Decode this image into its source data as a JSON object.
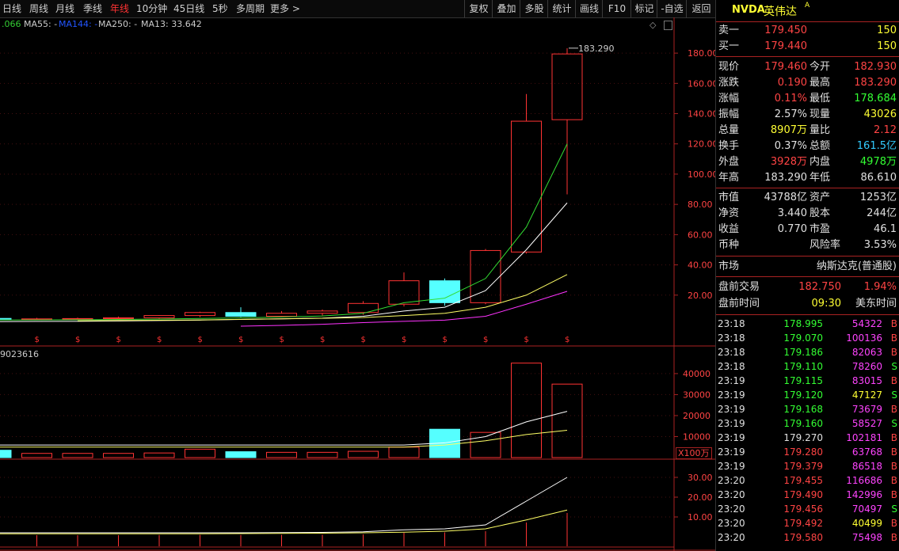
{
  "toolbar": {
    "periods": [
      "日线",
      "周线",
      "月线",
      "季线",
      "年线",
      "10分钟",
      "45日线",
      "5秒",
      "多周期",
      "更多 >"
    ],
    "active_index": 4,
    "tools": [
      "复权",
      "叠加",
      "多股",
      "统计",
      "画线",
      "F10",
      "标记",
      "-自选",
      "返回"
    ]
  },
  "ma_legend": [
    {
      "text": ".066",
      "color": "#33cc33"
    },
    {
      "text": "MA55: -",
      "color": "#cccccc"
    },
    {
      "text": "MA144: -",
      "color": "#2255ff"
    },
    {
      "text": "MA250: -",
      "color": "#cccccc"
    },
    {
      "text": "MA13: 33.642",
      "color": "#cccccc"
    }
  ],
  "vol_legend": "9023616",
  "volume_unit": "X100万",
  "chart_data": {
    "type": "candlestick",
    "price_axis": {
      "ticks": [
        "180.00",
        "160.00",
        "140.00",
        "120.00",
        "100.00",
        "80.00",
        "60.00",
        "40.00",
        "20.00"
      ],
      "ylim": [
        0,
        190
      ]
    },
    "volume_axis": {
      "ticks": [
        "40000",
        "30000",
        "20000",
        "10000"
      ],
      "ylim": [
        0,
        46000
      ]
    },
    "indicator_axis": {
      "ticks": [
        "30.00",
        "20.00",
        "10.00"
      ],
      "ylim": [
        0,
        32
      ]
    },
    "annotation": "183.290",
    "dividend_marker": "$",
    "candles": [
      {
        "open": 4.5,
        "high": 5.2,
        "low": 3.8,
        "close": 4.6,
        "volume": 3500,
        "ind": 2.0,
        "color": "cyan"
      },
      {
        "open": 4.2,
        "high": 5.0,
        "low": 3.5,
        "close": 4.3,
        "volume": 2000,
        "ind": 2.0,
        "color": "red"
      },
      {
        "open": 4.4,
        "high": 5.1,
        "low": 3.7,
        "close": 4.5,
        "volume": 2000,
        "ind": 2.0,
        "color": "red"
      },
      {
        "open": 4.8,
        "high": 5.8,
        "low": 4.0,
        "close": 5.0,
        "volume": 2000,
        "ind": 2.0,
        "color": "red"
      },
      {
        "open": 5.0,
        "high": 6.8,
        "low": 4.5,
        "close": 6.5,
        "volume": 2200,
        "ind": 2.2,
        "color": "red"
      },
      {
        "open": 6.5,
        "high": 9.0,
        "low": 5.5,
        "close": 8.5,
        "volume": 4000,
        "ind": 2.4,
        "color": "red"
      },
      {
        "open": 8.5,
        "high": 12.0,
        "low": 5.5,
        "close": 6.0,
        "volume": 2800,
        "ind": 2.3,
        "color": "cyan"
      },
      {
        "open": 6.0,
        "high": 9.5,
        "low": 5.5,
        "close": 8.0,
        "volume": 2500,
        "ind": 2.4,
        "color": "red"
      },
      {
        "open": 8.0,
        "high": 10.5,
        "low": 6.5,
        "close": 9.5,
        "volume": 2500,
        "ind": 2.6,
        "color": "red"
      },
      {
        "open": 8.5,
        "high": 16.0,
        "low": 7.0,
        "close": 14.5,
        "volume": 3000,
        "ind": 3.0,
        "color": "red"
      },
      {
        "open": 14.0,
        "high": 35.0,
        "low": 12.5,
        "close": 29.5,
        "volume": 5000,
        "ind": 5.0,
        "color": "red"
      },
      {
        "open": 29.5,
        "high": 31.0,
        "low": 13.0,
        "close": 15.0,
        "volume": 13500,
        "ind": 5.5,
        "color": "cyan"
      },
      {
        "open": 15.0,
        "high": 50.5,
        "low": 14.0,
        "close": 49.5,
        "volume": 12000,
        "ind": 7.0,
        "color": "red"
      },
      {
        "open": 48.5,
        "high": 153.0,
        "low": 47.5,
        "close": 135.0,
        "volume": 45000,
        "ind": 18.0,
        "color": "red"
      },
      {
        "open": 136.0,
        "high": 183.29,
        "low": 86.61,
        "close": 179.46,
        "volume": 35000,
        "ind": 30.0,
        "color": "red"
      }
    ],
    "ma_green": [
      3.5,
      3.6,
      3.7,
      3.9,
      4.2,
      4.6,
      5.0,
      5.5,
      6.2,
      8.0,
      15.0,
      18.0,
      31.0,
      65.0,
      120.0
    ],
    "ma_white": [
      2.5,
      2.6,
      2.7,
      2.9,
      3.2,
      3.5,
      3.9,
      4.3,
      4.8,
      6.0,
      9.5,
      12.0,
      23.0,
      50.0,
      81.0
    ],
    "ma_yellow": [
      null,
      null,
      3.0,
      3.2,
      3.4,
      3.6,
      4.0,
      4.3,
      4.7,
      5.2,
      6.5,
      8.0,
      12.0,
      20.0,
      33.6
    ],
    "ma_magenta": [
      null,
      null,
      null,
      null,
      null,
      null,
      -0.5,
      0.0,
      0.7,
      1.8,
      2.7,
      3.5,
      6.0,
      14.0,
      22.5
    ],
    "vol_ma_white": [
      6000,
      6000,
      6000,
      6000,
      6000,
      6000,
      6000,
      6000,
      6000,
      6000,
      6000,
      7000,
      10000,
      17000,
      22000
    ],
    "vol_ma_yellow": [
      5000,
      5000,
      5000,
      5000,
      5000,
      5000,
      5000,
      5000,
      5000,
      5000,
      5000,
      6000,
      8000,
      11000,
      13000
    ],
    "ind_line_white": [
      2.0,
      2.0,
      2.0,
      2.0,
      2.0,
      2.0,
      2.0,
      2.1,
      2.2,
      2.5,
      3.5,
      4.0,
      6.0,
      18.0,
      30.0
    ],
    "ind_line_yellow": [
      1.5,
      1.5,
      1.5,
      1.5,
      1.5,
      1.5,
      1.6,
      1.7,
      1.8,
      2.0,
      2.3,
      2.8,
      4.0,
      8.5,
      13.5
    ]
  },
  "panel": {
    "ticker": "NVDA",
    "name": "英伟达",
    "badge": "A",
    "ask": {
      "label": "卖一",
      "price": "179.450",
      "vol": "150"
    },
    "bid": {
      "label": "买一",
      "price": "179.440",
      "vol": "150"
    },
    "quote_rows": [
      {
        "l1": "现价",
        "v1": "179.460",
        "c1": "#ff4444",
        "l2": "今开",
        "v2": "182.930",
        "c2": "#ff4444"
      },
      {
        "l1": "涨跌",
        "v1": "0.190",
        "c1": "#ff4444",
        "l2": "最高",
        "v2": "183.290",
        "c2": "#ff4444"
      },
      {
        "l1": "涨幅",
        "v1": "0.11%",
        "c1": "#ff4444",
        "l2": "最低",
        "v2": "178.684",
        "c2": "#33ff33"
      },
      {
        "l1": "振幅",
        "v1": "2.57%",
        "c1": "#e0e0e0",
        "l2": "现量",
        "v2": "43026",
        "c2": "#ffff33"
      },
      {
        "l1": "总量",
        "v1": "8907万",
        "c1": "#ffff33",
        "l2": "量比",
        "v2": "2.12",
        "c2": "#ff4444"
      },
      {
        "l1": "换手",
        "v1": "0.37%",
        "c1": "#e0e0e0",
        "l2": "总额",
        "v2": "161.5亿",
        "c2": "#33ccff"
      },
      {
        "l1": "外盘",
        "v1": "3928万",
        "c1": "#ff4444",
        "l2": "内盘",
        "v2": "4978万",
        "c2": "#33ff33"
      },
      {
        "l1": "年高",
        "v1": "183.290",
        "c1": "#e0e0e0",
        "l2": "年低",
        "v2": "86.610",
        "c2": "#e0e0e0"
      }
    ],
    "fund_rows": [
      {
        "l1": "市值",
        "v1": "43788亿",
        "l2": "资产",
        "v2": "1253亿"
      },
      {
        "l1": "净资",
        "v1": "3.440",
        "l2": "股本",
        "v2": "244亿"
      },
      {
        "l1": "收益",
        "v1": "0.770",
        "l2": "市盈",
        "v2": "46.1"
      },
      {
        "l1": "币种",
        "v1": "",
        "l2": "风险率",
        "v2": "3.53%"
      }
    ],
    "market": {
      "label": "市场",
      "value": "纳斯达克(普通股)"
    },
    "premarket": {
      "label": "盘前交易",
      "price": "182.750",
      "pct": "1.94%"
    },
    "premarket_time": {
      "label": "盘前时间",
      "time": "09:30",
      "zone": "美东时间"
    },
    "ticks": [
      {
        "t": "23:18",
        "p": "178.995",
        "pc": "#33ff33",
        "v": "54322",
        "vc": "#ff44ff",
        "s": "B",
        "sc": "#ff4444"
      },
      {
        "t": "23:18",
        "p": "179.070",
        "pc": "#33ff33",
        "v": "100136",
        "vc": "#ff44ff",
        "s": "B",
        "sc": "#ff4444"
      },
      {
        "t": "23:18",
        "p": "179.186",
        "pc": "#33ff33",
        "v": "82063",
        "vc": "#ff44ff",
        "s": "B",
        "sc": "#ff4444"
      },
      {
        "t": "23:18",
        "p": "179.110",
        "pc": "#33ff33",
        "v": "78260",
        "vc": "#ff44ff",
        "s": "S",
        "sc": "#33ff33"
      },
      {
        "t": "23:19",
        "p": "179.115",
        "pc": "#33ff33",
        "v": "83015",
        "vc": "#ff44ff",
        "s": "B",
        "sc": "#ff4444"
      },
      {
        "t": "23:19",
        "p": "179.120",
        "pc": "#33ff33",
        "v": "47127",
        "vc": "#ffff33",
        "s": "S",
        "sc": "#33ff33"
      },
      {
        "t": "23:19",
        "p": "179.168",
        "pc": "#33ff33",
        "v": "73679",
        "vc": "#ff44ff",
        "s": "B",
        "sc": "#ff4444"
      },
      {
        "t": "23:19",
        "p": "179.160",
        "pc": "#33ff33",
        "v": "58527",
        "vc": "#ff44ff",
        "s": "S",
        "sc": "#33ff33"
      },
      {
        "t": "23:19",
        "p": "179.270",
        "pc": "#e0e0e0",
        "v": "102181",
        "vc": "#ff44ff",
        "s": "B",
        "sc": "#ff4444"
      },
      {
        "t": "23:19",
        "p": "179.280",
        "pc": "#ff4444",
        "v": "63768",
        "vc": "#ff44ff",
        "s": "B",
        "sc": "#ff4444"
      },
      {
        "t": "23:19",
        "p": "179.379",
        "pc": "#ff4444",
        "v": "86518",
        "vc": "#ff44ff",
        "s": "B",
        "sc": "#ff4444"
      },
      {
        "t": "23:20",
        "p": "179.455",
        "pc": "#ff4444",
        "v": "116686",
        "vc": "#ff44ff",
        "s": "B",
        "sc": "#ff4444"
      },
      {
        "t": "23:20",
        "p": "179.490",
        "pc": "#ff4444",
        "v": "142996",
        "vc": "#ff44ff",
        "s": "B",
        "sc": "#ff4444"
      },
      {
        "t": "23:20",
        "p": "179.456",
        "pc": "#ff4444",
        "v": "70497",
        "vc": "#ff44ff",
        "s": "S",
        "sc": "#33ff33"
      },
      {
        "t": "23:20",
        "p": "179.492",
        "pc": "#ff4444",
        "v": "40499",
        "vc": "#ffff33",
        "s": "B",
        "sc": "#ff4444"
      },
      {
        "t": "23:20",
        "p": "179.580",
        "pc": "#ff4444",
        "v": "75498",
        "vc": "#ff44ff",
        "s": "B",
        "sc": "#ff4444"
      }
    ]
  },
  "colors": {
    "up": "#ff3333",
    "down": "#55ffff",
    "axis": "#aa2222",
    "ma_green": "#33dd33",
    "ma_white": "#ffffff",
    "ma_yellow": "#ffff66",
    "ma_magenta": "#ff33ff"
  }
}
